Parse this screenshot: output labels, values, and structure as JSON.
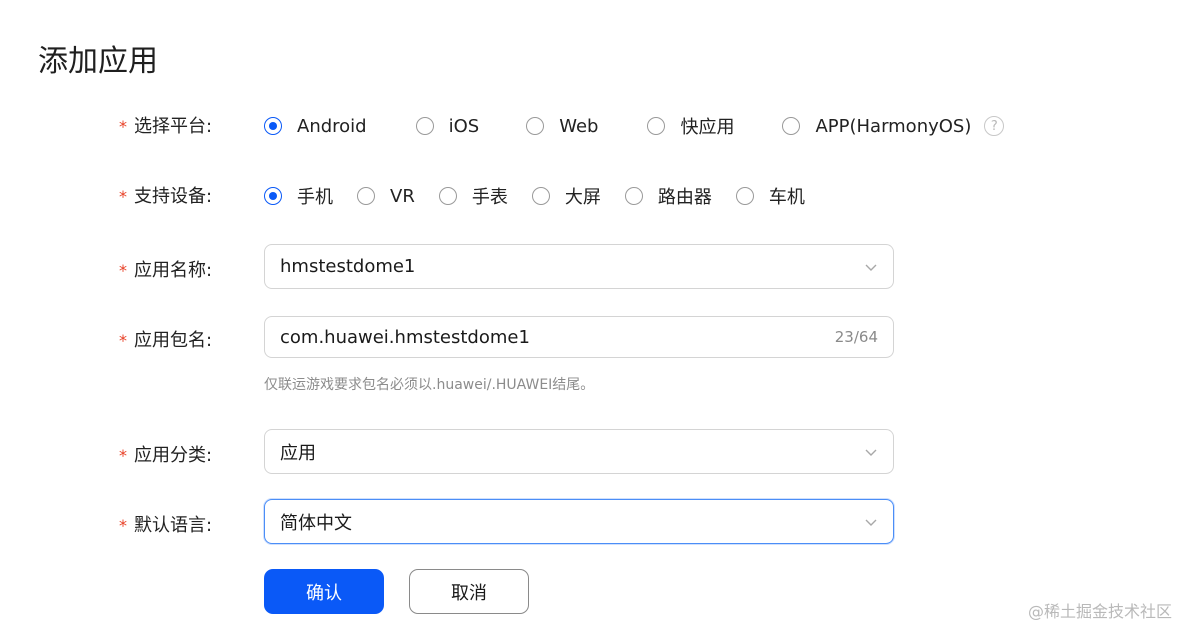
{
  "title": "添加应用",
  "platform": {
    "label": "选择平台:",
    "options": [
      {
        "label": "Android",
        "selected": true
      },
      {
        "label": "iOS",
        "selected": false
      },
      {
        "label": "Web",
        "selected": false
      },
      {
        "label": "快应用",
        "selected": false
      },
      {
        "label": "APP(HarmonyOS)",
        "selected": false
      }
    ],
    "help_icon": "?"
  },
  "devices": {
    "label": "支持设备:",
    "options": [
      {
        "label": "手机",
        "selected": true
      },
      {
        "label": "VR",
        "selected": false
      },
      {
        "label": "手表",
        "selected": false
      },
      {
        "label": "大屏",
        "selected": false
      },
      {
        "label": "路由器",
        "selected": false
      },
      {
        "label": "车机",
        "selected": false
      }
    ]
  },
  "app_name": {
    "label": "应用名称:",
    "value": "hmstestdome1"
  },
  "package_name": {
    "label": "应用包名:",
    "value": "com.huawei.hmstestdome1",
    "counter": "23/64",
    "hint": "仅联运游戏要求包名必须以.huawei/.HUAWEI结尾。"
  },
  "category": {
    "label": "应用分类:",
    "value": "应用"
  },
  "language": {
    "label": "默认语言:",
    "value": "简体中文"
  },
  "buttons": {
    "confirm": "确认",
    "cancel": "取消"
  },
  "watermark": "@稀土掘金技术社区",
  "colors": {
    "accent": "#0a59f7",
    "required_star": "#e84026"
  }
}
